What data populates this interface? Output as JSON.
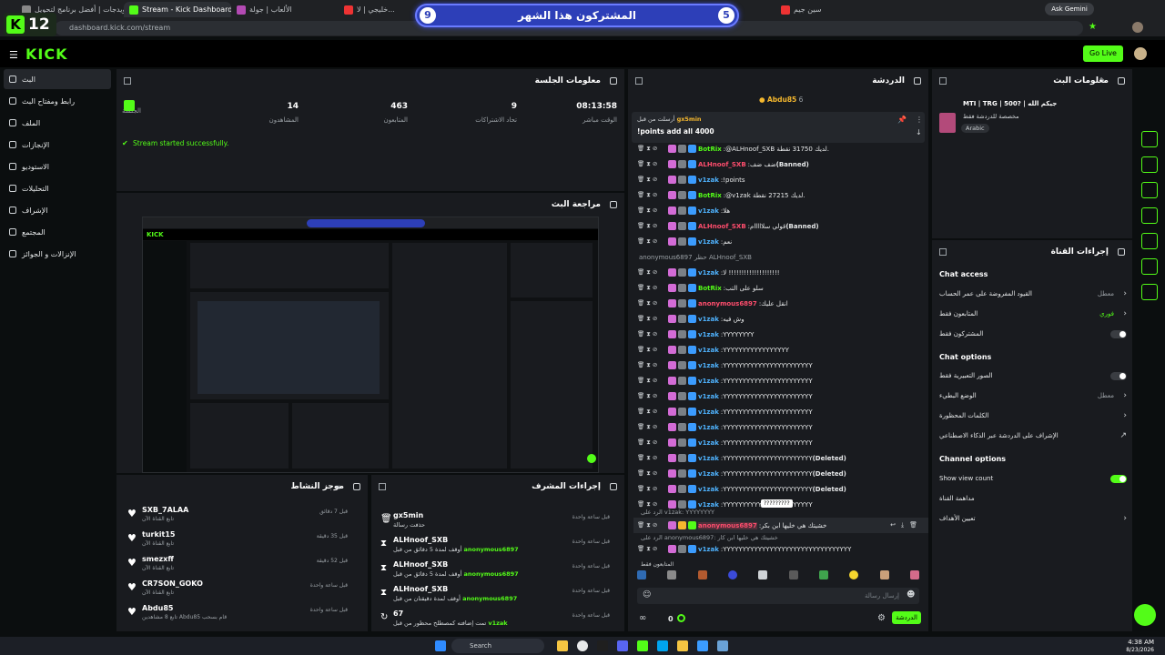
{
  "browser": {
    "tabs": [
      {
        "label": "الويدجات | أفضل برنامج لتحويل",
        "active": false
      },
      {
        "label": "Stream - Kick Dashboard",
        "active": true
      },
      {
        "label": "الألعاب | جولة",
        "active": false
      },
      {
        "label": "خليجي | لا...",
        "active": false
      },
      {
        "label": "...",
        "active": false
      },
      {
        "label": "سين جيم",
        "active": false
      }
    ],
    "url": "dashboard.kick.com/stream",
    "ask_gemini": "Ask Gemini"
  },
  "overlay": {
    "kick_count": "12",
    "subs_title": "المشتركون هذا الشهر",
    "subs_left": "9",
    "subs_right": "5"
  },
  "topbar": {
    "logo": "KICK",
    "go_live": "Go Live"
  },
  "sidebar": {
    "items": [
      {
        "label": "البث",
        "selected": true
      },
      {
        "label": "رابط ومفتاح البث"
      },
      {
        "label": "الملف"
      },
      {
        "label": "الإنجازات"
      },
      {
        "label": "الاستوديو"
      },
      {
        "label": "التحليلات"
      },
      {
        "label": "الإشراف"
      },
      {
        "label": "المجتمع"
      },
      {
        "label": "الإنزالات و الجوائز"
      }
    ]
  },
  "session": {
    "title": "معلومات الجلسة",
    "stats": [
      {
        "value": "08:13:58",
        "label": "الوقت مباشر"
      },
      {
        "value": "9",
        "label": "تحاد الاشتراكات"
      },
      {
        "value": "463",
        "label": "المتابعون"
      },
      {
        "value": "14",
        "label": "المشاهدون"
      },
      {
        "value": "",
        "label": "الجلسة"
      }
    ],
    "status": "Stream started successfully."
  },
  "preview": {
    "title": "مراجعة البث"
  },
  "activity": {
    "title": "موجز النشاط",
    "items": [
      {
        "name": "SXB_7ALAA",
        "sub": "تابع القناة الآن",
        "time": "قبل 7 دقائق"
      },
      {
        "name": "turkit15",
        "sub": "تابع القناة الآن",
        "time": "قبل 35 دقيقة"
      },
      {
        "name": "smezxff",
        "sub": "تابع القناة الآن",
        "time": "قبل 52 دقيقة"
      },
      {
        "name": "CR7SON_GOKO",
        "sub": "تابع القناة الآن",
        "time": "قبل ساعة واحدة"
      },
      {
        "name": "Abdu85",
        "sub": "تابع 8 مشاهدين Abdu85 قام بسحب",
        "time": "قبل ساعة واحدة"
      }
    ]
  },
  "modactions": {
    "title": "إجراءات المشرف",
    "items": [
      {
        "name": "gx5min",
        "sub": "حذفت رسالة",
        "hl": "",
        "time": "قبل ساعة واحدة"
      },
      {
        "name": "ALHnoof_SXB",
        "sub": "أوقف لمدة 5 دقائق من قبل",
        "hl": "anonymous6897",
        "time": "قبل ساعة واحدة"
      },
      {
        "name": "ALHnoof_SXB",
        "sub": "أوقف لمدة 5 دقائق من قبل",
        "hl": "anonymous6897",
        "time": "قبل ساعة واحدة"
      },
      {
        "name": "ALHnoof_SXB",
        "sub": "أوقف لمدة دقيقتان من قبل",
        "hl": "anonymous6897",
        "time": "قبل ساعة واحدة"
      },
      {
        "name": "67",
        "sub": "تمت إضافته كمصطلح محظور من قبل",
        "hl": "v1zak",
        "time": "قبل ساعة واحدة"
      }
    ]
  },
  "chat": {
    "title": "الدردشة",
    "top_user": "Abdu85",
    "top_count": "6",
    "pinned_user": "gx5min",
    "pinned_label": "أرسلت من قبل",
    "pinned_msg": "!points add all 4000",
    "messages": [
      {
        "user": "BotRix",
        "color": "#53fc18",
        "msg": "@ALHnoof_SXB لديك 31750 نقطة.",
        "flag": ""
      },
      {
        "user": "ALHnoof_SXB",
        "color": "#ff4d6d",
        "msg": "ضف ضف",
        "flag": "(Banned)"
      },
      {
        "user": "v1zak",
        "color": "#4fb3ff",
        "msg": "!points",
        "flag": ""
      },
      {
        "user": "BotRix",
        "color": "#53fc18",
        "msg": "@v1zak لديك 27215 نقطة.",
        "flag": ""
      },
      {
        "user": "v1zak",
        "color": "#4fb3ff",
        "msg": "هلا",
        "flag": ""
      },
      {
        "user": "ALHnoof_SXB",
        "color": "#ff4d6d",
        "msg": "قولي سلااااام",
        "flag": "(Banned)"
      },
      {
        "user": "v1zak",
        "color": "#4fb3ff",
        "msg": "نعم",
        "flag": ""
      },
      {
        "user": "",
        "color": "#9aa0a5",
        "msg": "anonymous6897 حظر ALHnoof_SXB",
        "flag": ""
      },
      {
        "user": "v1zak",
        "color": "#4fb3ff",
        "msg": "لا !!!!!!!!!!!!!!!!!!!!",
        "flag": ""
      },
      {
        "user": "BotRix",
        "color": "#53fc18",
        "msg": "سلو على التب",
        "flag": ""
      },
      {
        "user": "anonymous6897",
        "color": "#ff4d6d",
        "msg": "انقل عليك",
        "flag": ""
      },
      {
        "user": "v1zak",
        "color": "#4fb3ff",
        "msg": "وش فيه",
        "flag": ""
      },
      {
        "user": "v1zak",
        "color": "#4fb3ff",
        "msg": "YYYYYYYY",
        "flag": ""
      },
      {
        "user": "v1zak",
        "color": "#4fb3ff",
        "msg": "YYYYYYYYYYYYYYYYY",
        "flag": ""
      },
      {
        "user": "v1zak",
        "color": "#4fb3ff",
        "msg": "YYYYYYYYYYYYYYYYYYYYYYY",
        "flag": ""
      },
      {
        "user": "v1zak",
        "color": "#4fb3ff",
        "msg": "YYYYYYYYYYYYYYYYYYYYYYY",
        "flag": ""
      },
      {
        "user": "v1zak",
        "color": "#4fb3ff",
        "msg": "YYYYYYYYYYYYYYYYYYYYYYY",
        "flag": ""
      },
      {
        "user": "v1zak",
        "color": "#4fb3ff",
        "msg": "YYYYYYYYYYYYYYYYYYYYYYY",
        "flag": ""
      },
      {
        "user": "v1zak",
        "color": "#4fb3ff",
        "msg": "YYYYYYYYYYYYYYYYYYYYYYY",
        "flag": ""
      },
      {
        "user": "v1zak",
        "color": "#4fb3ff",
        "msg": "YYYYYYYYYYYYYYYYYYYYYYY",
        "flag": ""
      },
      {
        "user": "v1zak",
        "color": "#4fb3ff",
        "msg": "YYYYYYYYYYYYYYYYYYYYYYY",
        "flag": "(Deleted)"
      },
      {
        "user": "v1zak",
        "color": "#4fb3ff",
        "msg": "YYYYYYYYYYYYYYYYYYYYYYY",
        "flag": "(Deleted)"
      },
      {
        "user": "v1zak",
        "color": "#4fb3ff",
        "msg": "YYYYYYYYYYYYYYYYYYYYYYY",
        "flag": "(Deleted)"
      },
      {
        "user": "v1zak",
        "color": "#4fb3ff",
        "msg": "YYYYYYYYYYYYYYYYYYYYYYY",
        "flag": ""
      }
    ],
    "tooltip": "?????????",
    "reply1": "الرد على v1zak: YYYYYYYY",
    "highlight_user": "anonymous6897",
    "highlight_msg": "خشيتك هي خليها ابن بكر",
    "reply2": "الرد على anonymous6897: خشيتك هي خليها ابن كار",
    "last_user": "v1zak",
    "last_msg": "YYYYYYYYYYYYYYYYYYYYYYYYYYYYYYYYY",
    "emote_label": "المتابعون فقط",
    "input_placeholder": "إرسال رسالة",
    "counter": "0",
    "send": "الدردشة"
  },
  "streaminfo": {
    "title": "معلومات البث",
    "stream_title": "MTI | TRG | 500? | جيكم الله",
    "category": "مخصصة للدردشة فقط",
    "tag": "Arabic"
  },
  "channel": {
    "title": "إجراءات القناة",
    "chat_access": "Chat access",
    "rows1": [
      {
        "label": "القيود المفروضة على عمر الحساب",
        "value": "معطل",
        "type": "chev"
      },
      {
        "label": "المتابعون فقط",
        "value": "فوري",
        "type": "chev"
      },
      {
        "label": "المشتركون فقط",
        "value": "",
        "type": "toggle-off"
      }
    ],
    "chat_options": "Chat options",
    "rows2": [
      {
        "label": "الصور التعبيرية فقط",
        "value": "",
        "type": "toggle-off"
      },
      {
        "label": "الوضع البطيء",
        "value": "معطل",
        "type": "chev"
      },
      {
        "label": "الكلمات المحظورة",
        "value": "",
        "type": "chev"
      },
      {
        "label": "الإشراف على الدردشة عبر الذكاء الاصطناعي",
        "value": "",
        "type": "ext"
      }
    ],
    "channel_options": "Channel options",
    "rows3": [
      {
        "label": "Show view count",
        "value": "",
        "type": "toggle-on"
      },
      {
        "label": "مداهمة القناة",
        "value": "",
        "type": "none"
      },
      {
        "label": "تعيين الأهداف",
        "value": "",
        "type": "chev"
      }
    ]
  },
  "taskbar": {
    "search": "Search",
    "time": "4:38 AM",
    "date": "8/23/2026"
  }
}
